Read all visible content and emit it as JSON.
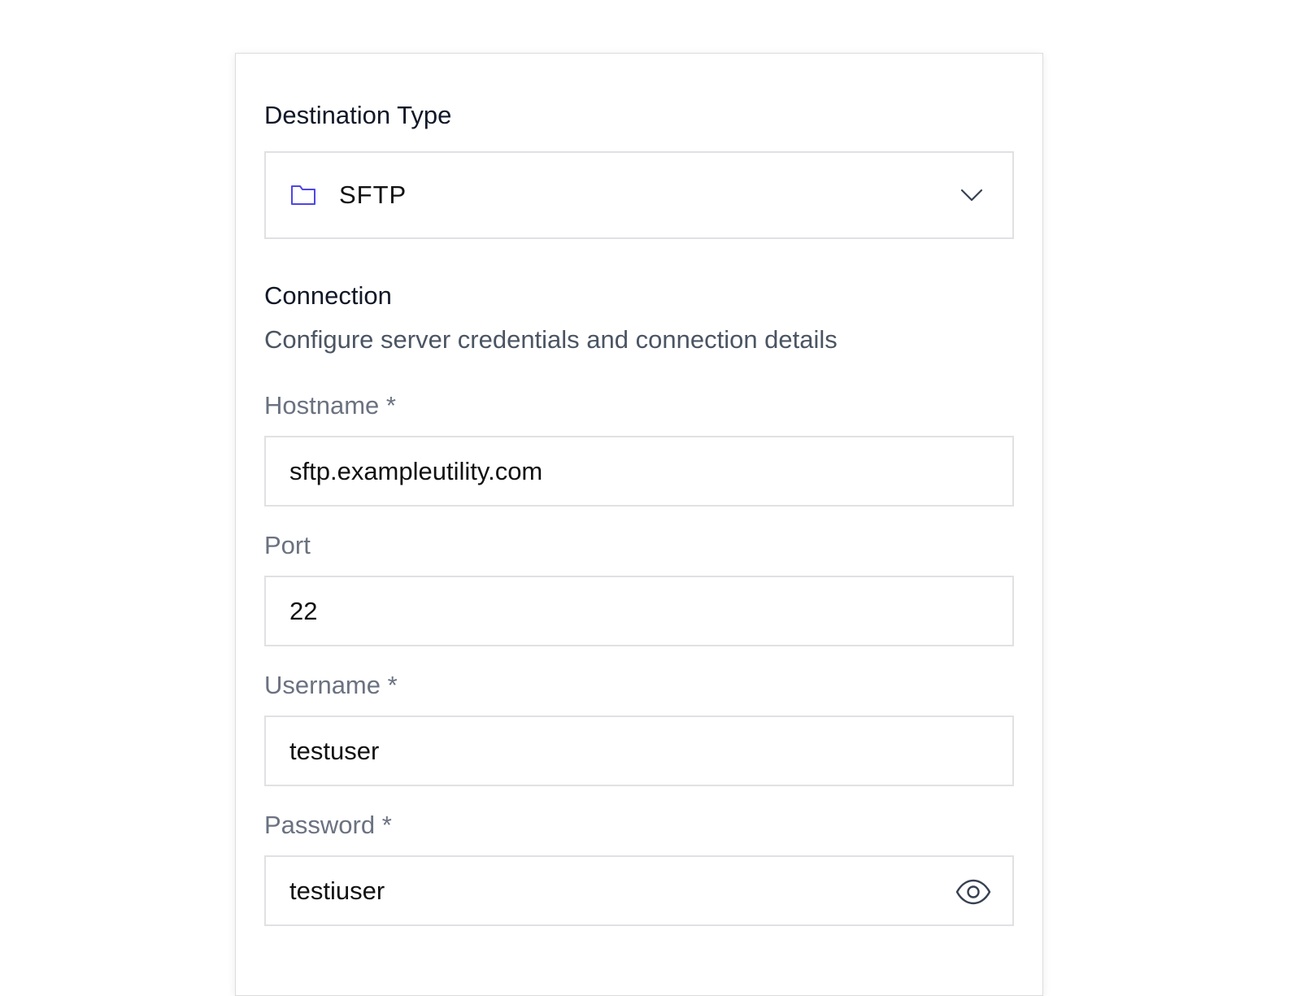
{
  "destination": {
    "label": "Destination Type",
    "selected": "SFTP",
    "icon": "folder-icon",
    "accent_color": "#4f46e5"
  },
  "connection": {
    "title": "Connection",
    "description": "Configure server credentials and connection details"
  },
  "fields": {
    "hostname": {
      "label": "Hostname *",
      "value": "sftp.exampleutility.com"
    },
    "port": {
      "label": "Port",
      "value": "22"
    },
    "username": {
      "label": "Username *",
      "value": "testuser"
    },
    "password": {
      "label": "Password *",
      "value": "testiuser",
      "toggle_icon": "eye-icon"
    }
  }
}
